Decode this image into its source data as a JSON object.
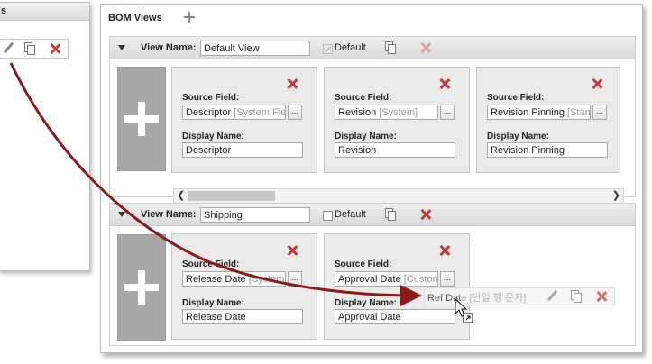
{
  "left_panel": {
    "title_fragment": "s"
  },
  "main": {
    "title": "BOM Views",
    "views": [
      {
        "view_name_label": "View Name:",
        "view_name": "Default View",
        "default_label": "Default",
        "fields": [
          {
            "source_label": "Source Field:",
            "source_value": "Descriptor",
            "source_hint": "[System Fiel",
            "display_label": "Display Name:",
            "display_value": "Descriptor",
            "ellipsis": "..."
          },
          {
            "source_label": "Source Field:",
            "source_value": "Revision",
            "source_hint": "[System]",
            "display_label": "Display Name:",
            "display_value": "Revision",
            "ellipsis": "..."
          },
          {
            "source_label": "Source Field:",
            "source_value": "Revision Pinning",
            "source_hint": "[Stan",
            "display_label": "Display Name:",
            "display_value": "Revision Pinning",
            "ellipsis": "..."
          }
        ],
        "scroll_left": "❮",
        "scroll_right": "❯"
      },
      {
        "view_name_label": "View Name:",
        "view_name": "Shipping",
        "default_label": "Default",
        "fields": [
          {
            "source_label": "Source Field:",
            "source_value": "Release Date",
            "source_hint": "[System F",
            "display_label": "Display Name:",
            "display_value": "Release Date",
            "ellipsis": "..."
          },
          {
            "source_label": "Source Field:",
            "source_value": "Approval Date",
            "source_hint": "[Custom",
            "display_label": "Display Name:",
            "display_value": "Approval Date",
            "ellipsis": "..."
          }
        ]
      }
    ]
  },
  "drag_ghost": {
    "text": "Ref Dat",
    "hint": "e [단일 행 문자]"
  },
  "colors": {
    "arrow": "#8b1a1a",
    "delete": "#c23b3b",
    "plus_tile": "#a8a8a8"
  },
  "icons": [
    "pencil-icon",
    "copy-icon",
    "delete-icon",
    "add-icon",
    "move-cursor-icon"
  ]
}
